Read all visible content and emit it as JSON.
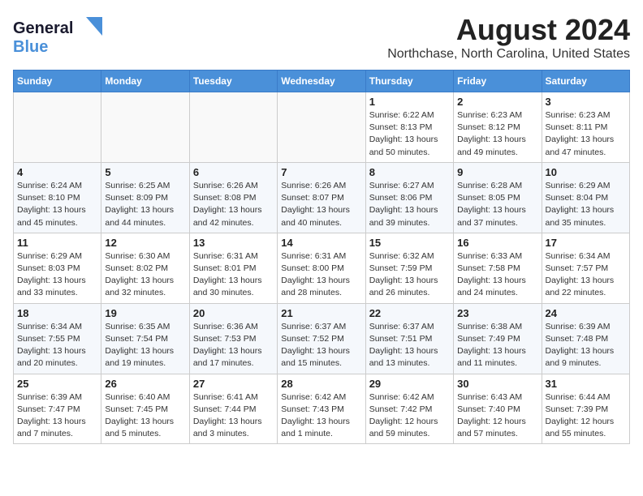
{
  "header": {
    "logo_general": "General",
    "logo_blue": "Blue",
    "title": "August 2024",
    "subtitle": "Northchase, North Carolina, United States"
  },
  "calendar": {
    "days_of_week": [
      "Sunday",
      "Monday",
      "Tuesday",
      "Wednesday",
      "Thursday",
      "Friday",
      "Saturday"
    ],
    "weeks": [
      [
        {
          "day": "",
          "info": ""
        },
        {
          "day": "",
          "info": ""
        },
        {
          "day": "",
          "info": ""
        },
        {
          "day": "",
          "info": ""
        },
        {
          "day": "1",
          "info": "Sunrise: 6:22 AM\nSunset: 8:13 PM\nDaylight: 13 hours\nand 50 minutes."
        },
        {
          "day": "2",
          "info": "Sunrise: 6:23 AM\nSunset: 8:12 PM\nDaylight: 13 hours\nand 49 minutes."
        },
        {
          "day": "3",
          "info": "Sunrise: 6:23 AM\nSunset: 8:11 PM\nDaylight: 13 hours\nand 47 minutes."
        }
      ],
      [
        {
          "day": "4",
          "info": "Sunrise: 6:24 AM\nSunset: 8:10 PM\nDaylight: 13 hours\nand 45 minutes."
        },
        {
          "day": "5",
          "info": "Sunrise: 6:25 AM\nSunset: 8:09 PM\nDaylight: 13 hours\nand 44 minutes."
        },
        {
          "day": "6",
          "info": "Sunrise: 6:26 AM\nSunset: 8:08 PM\nDaylight: 13 hours\nand 42 minutes."
        },
        {
          "day": "7",
          "info": "Sunrise: 6:26 AM\nSunset: 8:07 PM\nDaylight: 13 hours\nand 40 minutes."
        },
        {
          "day": "8",
          "info": "Sunrise: 6:27 AM\nSunset: 8:06 PM\nDaylight: 13 hours\nand 39 minutes."
        },
        {
          "day": "9",
          "info": "Sunrise: 6:28 AM\nSunset: 8:05 PM\nDaylight: 13 hours\nand 37 minutes."
        },
        {
          "day": "10",
          "info": "Sunrise: 6:29 AM\nSunset: 8:04 PM\nDaylight: 13 hours\nand 35 minutes."
        }
      ],
      [
        {
          "day": "11",
          "info": "Sunrise: 6:29 AM\nSunset: 8:03 PM\nDaylight: 13 hours\nand 33 minutes."
        },
        {
          "day": "12",
          "info": "Sunrise: 6:30 AM\nSunset: 8:02 PM\nDaylight: 13 hours\nand 32 minutes."
        },
        {
          "day": "13",
          "info": "Sunrise: 6:31 AM\nSunset: 8:01 PM\nDaylight: 13 hours\nand 30 minutes."
        },
        {
          "day": "14",
          "info": "Sunrise: 6:31 AM\nSunset: 8:00 PM\nDaylight: 13 hours\nand 28 minutes."
        },
        {
          "day": "15",
          "info": "Sunrise: 6:32 AM\nSunset: 7:59 PM\nDaylight: 13 hours\nand 26 minutes."
        },
        {
          "day": "16",
          "info": "Sunrise: 6:33 AM\nSunset: 7:58 PM\nDaylight: 13 hours\nand 24 minutes."
        },
        {
          "day": "17",
          "info": "Sunrise: 6:34 AM\nSunset: 7:57 PM\nDaylight: 13 hours\nand 22 minutes."
        }
      ],
      [
        {
          "day": "18",
          "info": "Sunrise: 6:34 AM\nSunset: 7:55 PM\nDaylight: 13 hours\nand 20 minutes."
        },
        {
          "day": "19",
          "info": "Sunrise: 6:35 AM\nSunset: 7:54 PM\nDaylight: 13 hours\nand 19 minutes."
        },
        {
          "day": "20",
          "info": "Sunrise: 6:36 AM\nSunset: 7:53 PM\nDaylight: 13 hours\nand 17 minutes."
        },
        {
          "day": "21",
          "info": "Sunrise: 6:37 AM\nSunset: 7:52 PM\nDaylight: 13 hours\nand 15 minutes."
        },
        {
          "day": "22",
          "info": "Sunrise: 6:37 AM\nSunset: 7:51 PM\nDaylight: 13 hours\nand 13 minutes."
        },
        {
          "day": "23",
          "info": "Sunrise: 6:38 AM\nSunset: 7:49 PM\nDaylight: 13 hours\nand 11 minutes."
        },
        {
          "day": "24",
          "info": "Sunrise: 6:39 AM\nSunset: 7:48 PM\nDaylight: 13 hours\nand 9 minutes."
        }
      ],
      [
        {
          "day": "25",
          "info": "Sunrise: 6:39 AM\nSunset: 7:47 PM\nDaylight: 13 hours\nand 7 minutes."
        },
        {
          "day": "26",
          "info": "Sunrise: 6:40 AM\nSunset: 7:45 PM\nDaylight: 13 hours\nand 5 minutes."
        },
        {
          "day": "27",
          "info": "Sunrise: 6:41 AM\nSunset: 7:44 PM\nDaylight: 13 hours\nand 3 minutes."
        },
        {
          "day": "28",
          "info": "Sunrise: 6:42 AM\nSunset: 7:43 PM\nDaylight: 13 hours\nand 1 minute."
        },
        {
          "day": "29",
          "info": "Sunrise: 6:42 AM\nSunset: 7:42 PM\nDaylight: 12 hours\nand 59 minutes."
        },
        {
          "day": "30",
          "info": "Sunrise: 6:43 AM\nSunset: 7:40 PM\nDaylight: 12 hours\nand 57 minutes."
        },
        {
          "day": "31",
          "info": "Sunrise: 6:44 AM\nSunset: 7:39 PM\nDaylight: 12 hours\nand 55 minutes."
        }
      ]
    ]
  }
}
